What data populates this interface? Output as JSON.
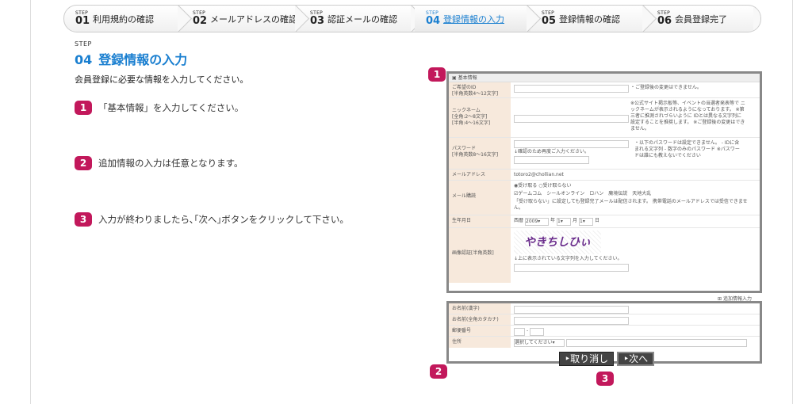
{
  "steps": [
    {
      "step": "STEP",
      "num": "01",
      "label": "利用規約の確認"
    },
    {
      "step": "STEP",
      "num": "02",
      "label": "メールアドレスの確認"
    },
    {
      "step": "STEP",
      "num": "03",
      "label": "認証メールの確認"
    },
    {
      "step": "STEP",
      "num": "04",
      "label": "登録情報の入力"
    },
    {
      "step": "STEP",
      "num": "05",
      "label": "登録情報の確認"
    },
    {
      "step": "STEP",
      "num": "06",
      "label": "会員登録完了"
    }
  ],
  "heading": {
    "step": "STEP",
    "num": "04",
    "title": "登録情報の入力",
    "intro": "会員登録に必要な情報を入力してください。"
  },
  "instructions": [
    {
      "num": "1",
      "text": "「基本情報」を入力してください。"
    },
    {
      "num": "2",
      "text": "追加情報の入力は任意となります。"
    },
    {
      "num": "3",
      "text": "入力が終わりましたら､｢次へ｣ボタンをクリックして下さい。"
    }
  ],
  "form": {
    "section": "基本情報",
    "id_label": "ご希望のID\n[半角英数4～12文字]",
    "id_note": "・ご登録後の変更はできません。",
    "nick_label": "ニックネーム\n[全角:2～8文字]\n[半角:4～16文字]",
    "nick_note": "※公式サイト掲示板等、イベントの当選者発表等で ニックネームが表示されるようになっております。 ※第三者に推測されづらいように IDとは異なる文字列に設定することを推奨します。 ※ご登録後の変更はできません。",
    "pw_label": "パスワード\n[半角英数8～16文字]",
    "pw_confirm": "↓確認のため再度ご入力ください。",
    "pw_note": "・以下のパスワードは設定できません。 - IDに含まれる文字列 - 数字のみのパスワード ※パスワードは誰にも教えないでください",
    "mail_label": "メールアドレス",
    "mail_value": "totoro2@chollian.net",
    "news_label": "メール購読",
    "news_receive": "受け取る",
    "news_no": "受け取らない",
    "news_items": "ゲームコム　シールオンライン　ロハン　魔境伝説　天地大乱",
    "news_note": "「受け取らない」に設定しても登録完了メールは配信されます。 携帯電話のメールアドレスでは受信できません。",
    "birth_label": "生年月日",
    "birth_prefix": "西暦",
    "birth_year": "2009",
    "birth_y": "年",
    "birth_month": "1",
    "birth_m": "月",
    "birth_day": "1",
    "birth_d": "日",
    "captcha_label": "画像認証[半角英数]",
    "captcha_text": "やきちしひぃ",
    "captcha_note": "↓上に表示されている文字列を入力してください。",
    "add_link": "追加情報入力",
    "name_label": "お名前(漢字)",
    "kana_label": "お名前(全角カタカナ)",
    "zip_label": "郵便番号",
    "zip_sep": "-",
    "addr_label": "住所",
    "addr_select": "選択してください"
  },
  "buttons": {
    "cancel": "‣取り消し",
    "next": "‣次へ"
  },
  "badges": {
    "b1": "1",
    "b2": "2",
    "b3": "3"
  }
}
